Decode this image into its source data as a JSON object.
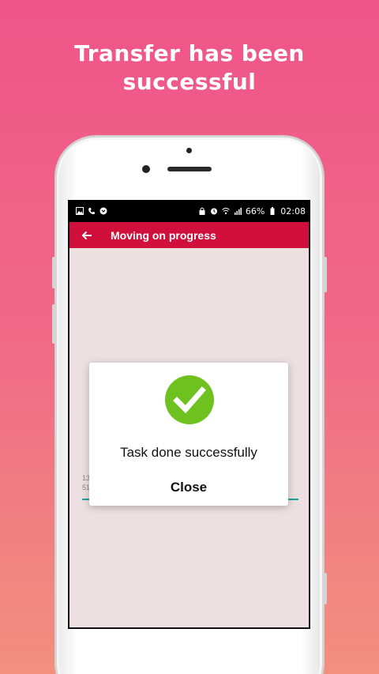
{
  "headline": {
    "line1": "Transfer has been",
    "line2": "successful"
  },
  "status_bar": {
    "battery": "66%",
    "time": "02:08"
  },
  "app_bar": {
    "title": "Moving on progress"
  },
  "background": {
    "line1": "13",
    "line2": "51"
  },
  "dialog": {
    "message": "Task done successfully",
    "close_label": "Close"
  },
  "colors": {
    "accent": "#d0103a",
    "success": "#6ec11f",
    "progress": "#1aa39a"
  }
}
